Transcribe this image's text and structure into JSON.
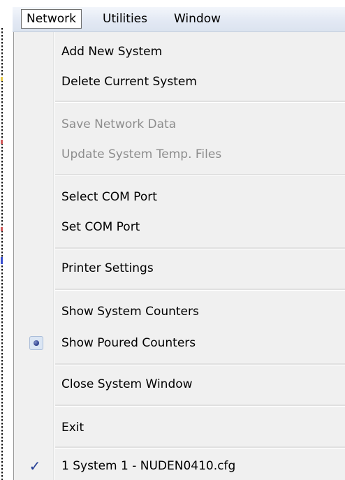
{
  "menubar": {
    "items": [
      {
        "label": "Network",
        "active": true
      },
      {
        "label": "Utilities",
        "active": false
      },
      {
        "label": "Window",
        "active": false
      }
    ]
  },
  "dropdown": {
    "items": [
      {
        "label": "Add New System",
        "enabled": true
      },
      {
        "label": "Delete Current System",
        "enabled": true
      },
      {
        "label": "Save Network Data",
        "enabled": false
      },
      {
        "label": "Update System Temp. Files",
        "enabled": false
      },
      {
        "label": "Select COM Port",
        "enabled": true
      },
      {
        "label": "Set COM Port",
        "enabled": true
      },
      {
        "label": "Printer Settings",
        "enabled": true
      },
      {
        "label": "Show System Counters",
        "enabled": true
      },
      {
        "label": "Show Poured Counters",
        "enabled": true,
        "indicator": "radio-dot-icon"
      },
      {
        "label": "Close System Window",
        "enabled": true
      },
      {
        "label": "Exit",
        "enabled": true
      },
      {
        "label": "1 System 1 - NUDEN0410.cfg",
        "enabled": true,
        "indicator": "checkmark-icon"
      }
    ]
  },
  "icons": {
    "checkmark": "✓"
  },
  "colors": {
    "menu_background": "#f0f0f0",
    "disabled_text": "#8d8d8d",
    "checkmark": "#1f3a93",
    "radio_dot": "#2a3c8a"
  }
}
